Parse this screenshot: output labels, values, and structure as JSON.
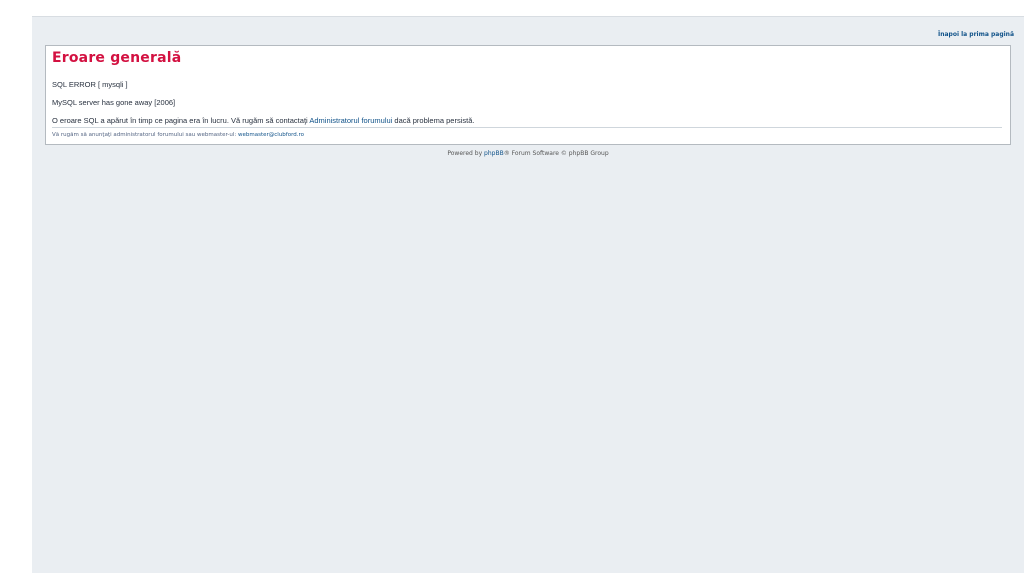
{
  "header": {
    "home_link": "Înapoi la prima pagină"
  },
  "error": {
    "title": "Eroare generală",
    "line1": "SQL ERROR [ mysqli ]",
    "line2": "MySQL server has gone away [2006]",
    "line3_before": "O eroare SQL a apărut în timp ce pagina era în lucru. Vă rugăm să contactaţi ",
    "line3_link": "Administratorul forumului",
    "line3_after": " dacă problema persistă.",
    "notify_text": "Vă rugăm să anunţaţi administratorul forumului sau webmaster-ul: ",
    "notify_email": "webmaster@clubford.ro"
  },
  "footer": {
    "before": "Powered by ",
    "phpbb_link": "phpBB",
    "after": "® Forum Software © phpBB Group"
  },
  "colors": {
    "title": "#d31141",
    "link": "#105289",
    "background": "#eaeef2"
  }
}
